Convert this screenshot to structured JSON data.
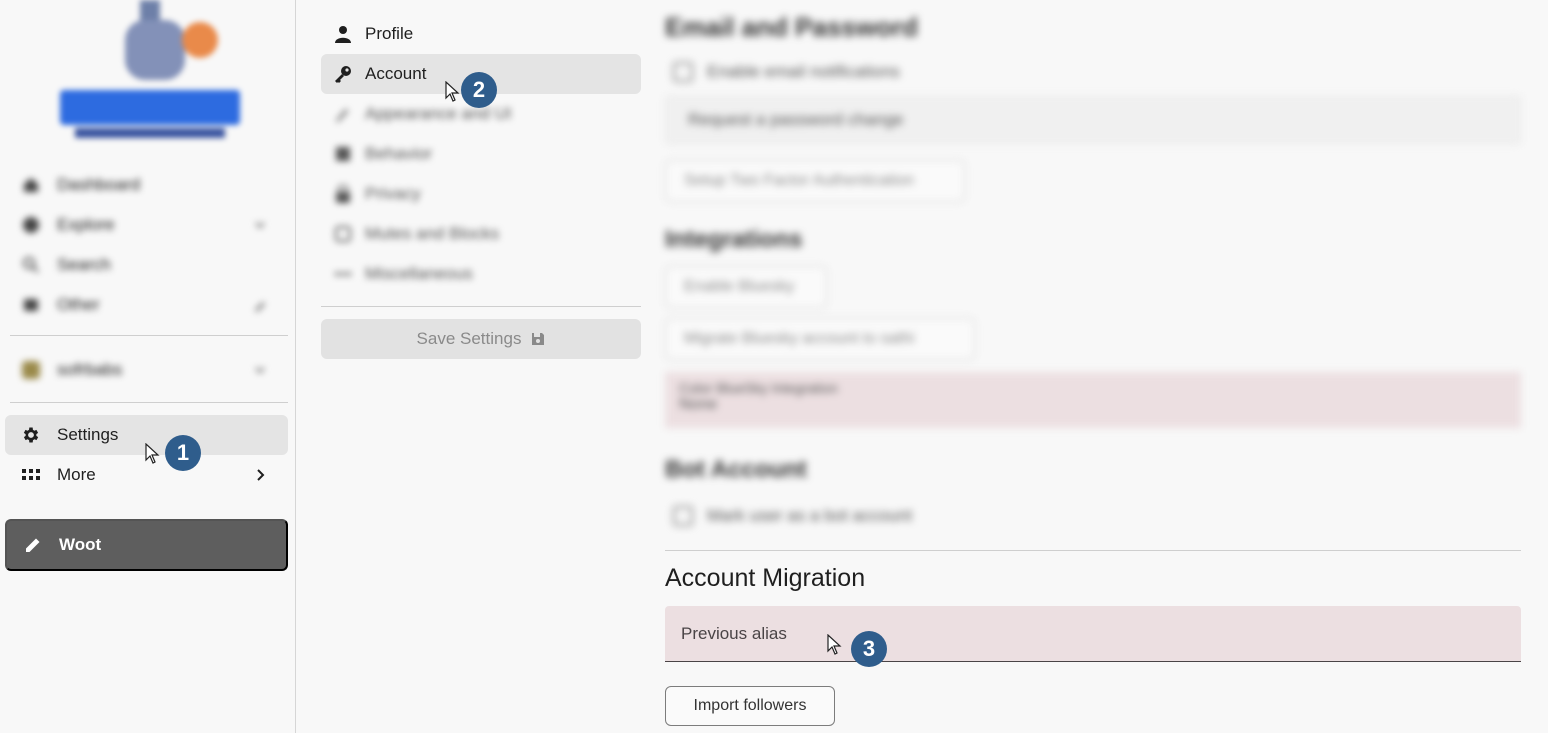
{
  "sidebar": {
    "blurred_items": [
      "Dashboard",
      "Explore",
      "Search",
      "Other"
    ],
    "account_blurred": "sofrbabs",
    "settings_label": "Settings",
    "more_label": "More",
    "woot_label": "Woot"
  },
  "settings_menu": {
    "items": [
      {
        "label": "Profile",
        "icon": "person-icon"
      },
      {
        "label": "Account",
        "icon": "key-icon"
      },
      {
        "label": "Appearance and UI",
        "icon": "brush-icon"
      },
      {
        "label": "Behavior",
        "icon": "tune-icon"
      },
      {
        "label": "Privacy",
        "icon": "lock-icon"
      },
      {
        "label": "Mutes and Blocks",
        "icon": "block-icon"
      },
      {
        "label": "Miscellaneous",
        "icon": "more-icon"
      }
    ],
    "save_label": "Save Settings"
  },
  "content": {
    "blurred": {
      "email_heading": "Email and Password",
      "email_notifications": "Enable email notifications",
      "password_select": "Request a password change",
      "two_factor": "Setup Two Factor Authentication",
      "integrations_heading": "Integrations",
      "enable_bluesky": "Enable Bluesky",
      "migrate_bluesky": "Migrate Bluesky account to sathi",
      "bluesky_note_label": "Color BlueSky Integration",
      "bluesky_note_value": "None",
      "bot_heading": "Bot Account",
      "bot_checkbox": "Mark user as a bot account"
    },
    "migration_title": "Account Migration",
    "previous_alias_placeholder": "Previous alias",
    "import_followers_label": "Import followers"
  },
  "annotations": {
    "step1": "1",
    "step2": "2",
    "step3": "3"
  },
  "colors": {
    "accent_badge": "#2f5d8c",
    "woot_button": "#5e5e5e",
    "field_pink": "#ecdfe1"
  }
}
